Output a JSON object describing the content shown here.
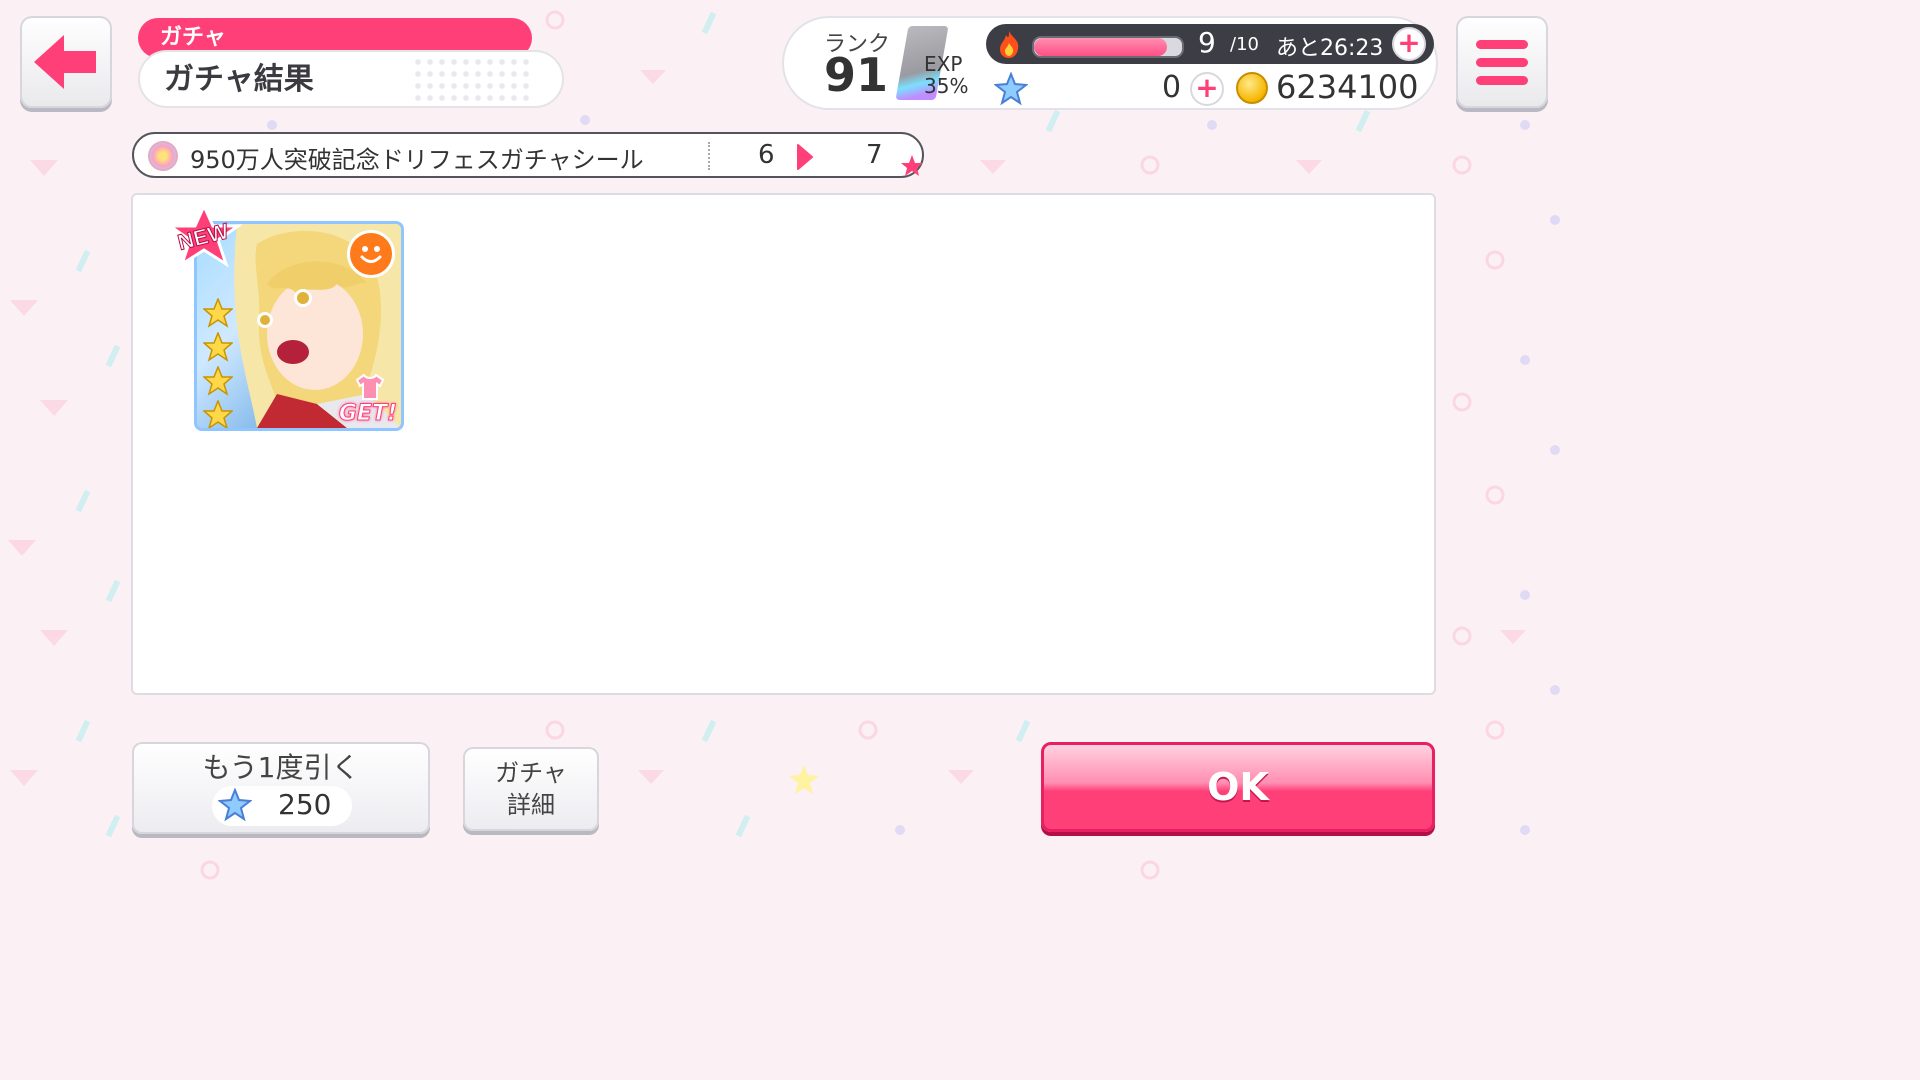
{
  "header": {
    "section_tab": "ガチャ",
    "page_title": "ガチャ結果"
  },
  "status": {
    "rank_label": "ランク",
    "rank_value": "91",
    "exp_label": "EXP",
    "exp_percent": "35%",
    "stamina_current": "9",
    "stamina_max": "/10",
    "stamina_timer": "あと26:23",
    "stamina_fill": 0.9,
    "star_gems": "0",
    "coins": "6234100"
  },
  "progress": {
    "label": "950万人突破記念ドリフェスガチャシール",
    "from": "6",
    "to": "7"
  },
  "result": {
    "new_badge": "NEW",
    "get_label": "GET!",
    "rarity": 4
  },
  "buttons": {
    "redraw_label": "もう1度引く",
    "redraw_cost": "250",
    "detail_line1": "ガチャ",
    "detail_line2": "詳細",
    "ok_label": "OK"
  },
  "colors": {
    "accent": "#ff3f78",
    "background": "#fbf1f4"
  }
}
